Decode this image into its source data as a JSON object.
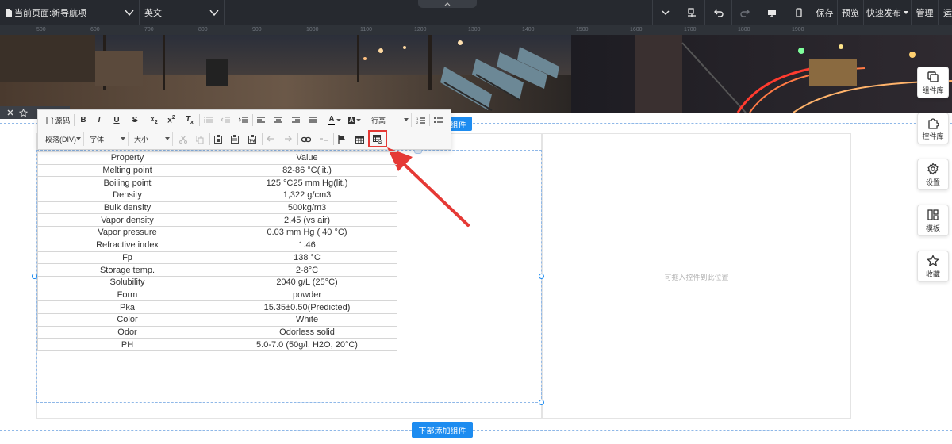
{
  "topbar": {
    "page_label": "当前页面:新导航项",
    "language": "英文",
    "save": "保存",
    "preview": "预览",
    "quick_publish": "快速发布",
    "manage": "管理",
    "more": "运"
  },
  "canvas": {
    "ruler_ticks": [
      "500",
      "600",
      "700",
      "800",
      "900",
      "1000",
      "1100",
      "1200",
      "1300",
      "1400",
      "1500",
      "1600",
      "1700",
      "1800",
      "1900"
    ],
    "add_component_top": "组件",
    "add_component_bottom": "下部添加组件",
    "drop_placeholder": "可拖入控件到此位置"
  },
  "editor_toolbar": {
    "source": "源码",
    "line_height": "行高",
    "paragraph": "段落(DIV)",
    "font": "字体",
    "size": "大小"
  },
  "table": {
    "header": [
      "Property",
      "Value"
    ],
    "rows": [
      [
        "Melting point",
        "82-86 °C(lit.)"
      ],
      [
        "Boiling point",
        "125 °C25 mm Hg(lit.)"
      ],
      [
        "Density",
        "1,322 g/cm3"
      ],
      [
        "Bulk density",
        "500kg/m3"
      ],
      [
        "Vapor density",
        "2.45 (vs air)"
      ],
      [
        "Vapor pressure",
        "0.03 mm Hg ( 40 °C)"
      ],
      [
        "Refractive index",
        "1.46"
      ],
      [
        "Fp",
        "138 °C"
      ],
      [
        "Storage temp.",
        "2-8°C"
      ],
      [
        "Solubility",
        "2040 g/L (25°C)"
      ],
      [
        "Form",
        "powder"
      ],
      [
        "Pka",
        "15.35±0.50(Predicted)"
      ],
      [
        "Color",
        "White"
      ],
      [
        "Odor",
        "Odorless solid"
      ],
      [
        "PH",
        "5.0-7.0 (50g/l, H2O, 20°C)"
      ]
    ]
  },
  "side_panel": {
    "components": "组件库",
    "controls": "控件库",
    "settings": "设置",
    "templates": "模板",
    "favorites": "收藏"
  },
  "colors": {
    "topbar_bg": "#26292f",
    "accent": "#1d8cf0",
    "highlight": "#e53935"
  }
}
